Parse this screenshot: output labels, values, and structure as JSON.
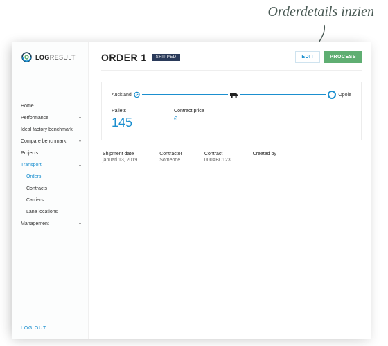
{
  "annotation": "Orderdetails inzien",
  "logo": {
    "bold": "LOG",
    "light": "RESULT"
  },
  "nav": {
    "items": [
      {
        "label": "Home",
        "expandable": false
      },
      {
        "label": "Performance",
        "expandable": true
      },
      {
        "label": "Ideal factory benchmark",
        "expandable": false
      },
      {
        "label": "Compare benchmark",
        "expandable": true
      },
      {
        "label": "Projects",
        "expandable": false
      },
      {
        "label": "Transport",
        "expandable": true,
        "active": true,
        "children": [
          {
            "label": "Orders",
            "active": true
          },
          {
            "label": "Contracts"
          },
          {
            "label": "Carriers"
          },
          {
            "label": "Lane locations"
          }
        ]
      },
      {
        "label": "Management",
        "expandable": true
      }
    ],
    "logout": "LOG OUT"
  },
  "header": {
    "title": "ORDER 1",
    "badge": "SHIPPED",
    "edit": "EDIT",
    "process": "PROCESS"
  },
  "route": {
    "from": "Auckland",
    "to": "Opole"
  },
  "metrics": {
    "pallets_label": "Pallets",
    "pallets_value": "145",
    "price_label": "Contract price",
    "price_value": "€"
  },
  "meta": {
    "shipment_label": "Shipment date",
    "shipment_value": "januari 13, 2019",
    "contractor_label": "Contractor",
    "contractor_value": "Someone",
    "contract_label": "Contract",
    "contract_value": "000ABC123",
    "created_label": "Created by",
    "created_value": ""
  }
}
